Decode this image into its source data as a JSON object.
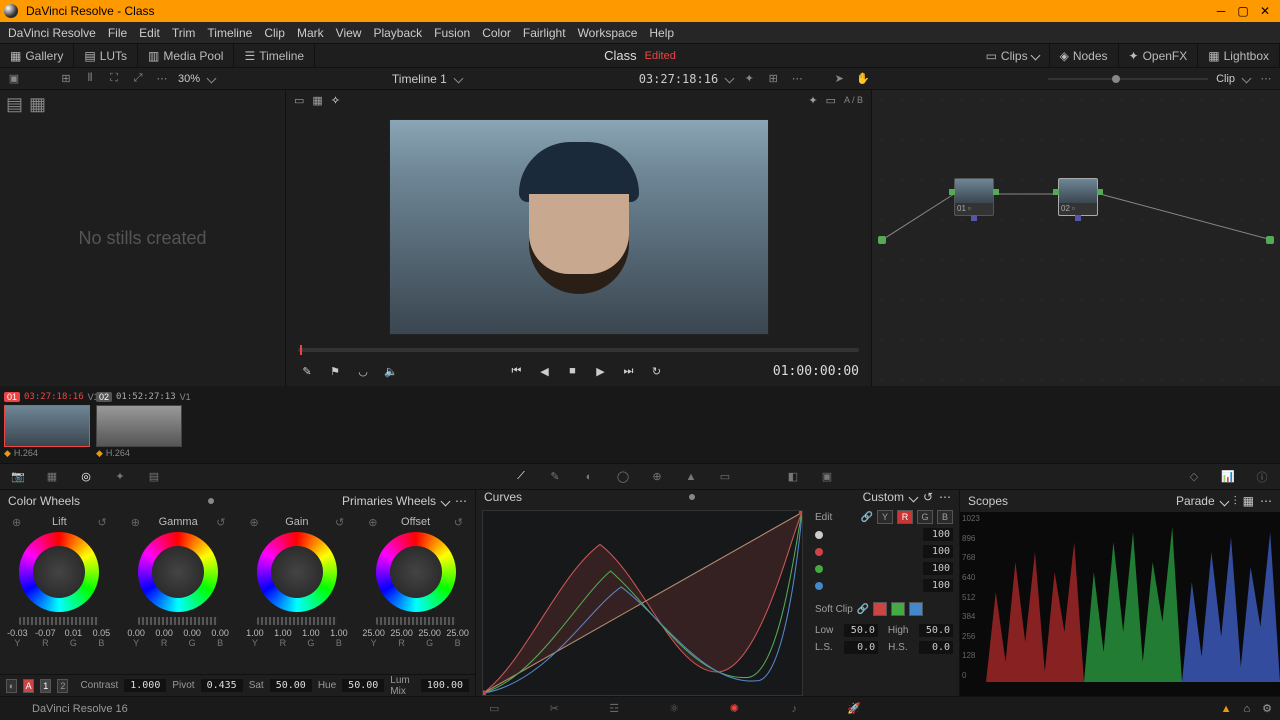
{
  "app": {
    "title": "DaVinci Resolve - Class"
  },
  "menu": [
    "DaVinci Resolve",
    "File",
    "Edit",
    "Trim",
    "Timeline",
    "Clip",
    "Mark",
    "View",
    "Playback",
    "Fusion",
    "Color",
    "Fairlight",
    "Workspace",
    "Help"
  ],
  "toolbar": {
    "gallery": "Gallery",
    "luts": "LUTs",
    "mediapool": "Media Pool",
    "timeline": "Timeline",
    "clips": "Clips",
    "nodes": "Nodes",
    "openfx": "OpenFX",
    "lightbox": "Lightbox"
  },
  "project": {
    "name": "Class",
    "status": "Edited"
  },
  "strip": {
    "zoom": "30%",
    "timeline": "Timeline 1",
    "tc": "03:27:18:16",
    "clipmode": "Clip",
    "ab": "A / B"
  },
  "gallery": {
    "empty": "No stills created"
  },
  "transport": {
    "tc": "01:00:00:00"
  },
  "nodegraph": {
    "n1": "01",
    "n2": "02"
  },
  "clips": [
    {
      "num": "01",
      "tc": "03:27:18:16",
      "track": "V1",
      "codec": "H.264",
      "active": true
    },
    {
      "num": "02",
      "tc": "01:52:27:13",
      "track": "V1",
      "codec": "H.264",
      "active": false
    }
  ],
  "wheels": {
    "title": "Color Wheels",
    "mode": "Primaries Wheels",
    "cols": [
      {
        "name": "Lift",
        "v": [
          "-0.03",
          "-0.07",
          "0.01",
          "0.05"
        ]
      },
      {
        "name": "Gamma",
        "v": [
          "0.00",
          "0.00",
          "0.00",
          "0.00"
        ]
      },
      {
        "name": "Gain",
        "v": [
          "1.00",
          "1.00",
          "1.00",
          "1.00"
        ]
      },
      {
        "name": "Offset",
        "v": [
          "25.00",
          "25.00",
          "25.00",
          "25.00"
        ]
      }
    ],
    "ch": [
      "Y",
      "R",
      "G",
      "B"
    ],
    "adj": {
      "page1": "1",
      "page2": "2",
      "contrast_l": "Contrast",
      "contrast": "1.000",
      "pivot_l": "Pivot",
      "pivot": "0.435",
      "sat_l": "Sat",
      "sat": "50.00",
      "hue_l": "Hue",
      "hue": "50.00",
      "lummix_l": "Lum Mix",
      "lummix": "100.00"
    }
  },
  "curves": {
    "title": "Curves",
    "mode": "Custom",
    "edit": "Edit",
    "ch": [
      "Y",
      "R",
      "G",
      "B"
    ],
    "intensity": [
      "100",
      "100",
      "100",
      "100"
    ],
    "softclip": "Soft Clip",
    "low_l": "Low",
    "low": "50.0",
    "high_l": "High",
    "high": "50.0",
    "ls_l": "L.S.",
    "ls": "0.0",
    "hs_l": "H.S.",
    "hs": "0.0"
  },
  "scopes": {
    "title": "Scopes",
    "mode": "Parade",
    "ticks": [
      "1023",
      "896",
      "768",
      "640",
      "512",
      "384",
      "256",
      "128",
      "0"
    ]
  },
  "status": {
    "brand": "DaVinci Resolve 16"
  }
}
